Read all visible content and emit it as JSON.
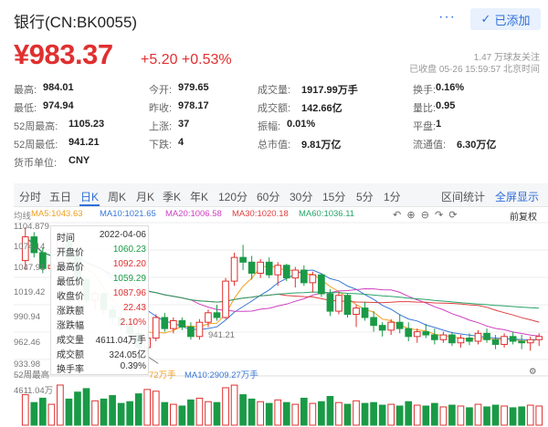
{
  "header": {
    "title": "银行(CN:BK0055)",
    "more": "···",
    "add_label": "已添加",
    "price": "¥983.37",
    "change": "+5.20 +0.53%",
    "followers": "1.47 万球友关注",
    "status": "已收盘 05-26 15:59:57 北京时间"
  },
  "stats": [
    [
      {
        "label": "最高:",
        "value": "984.01",
        "color": "red"
      },
      {
        "label": "今开:",
        "value": "979.65",
        "color": "red"
      },
      {
        "label": "成交量:",
        "value": "1917.99万手",
        "color": ""
      },
      {
        "label": "换手:",
        "value": "0.16%",
        "color": ""
      }
    ],
    [
      {
        "label": "最低:",
        "value": "974.94",
        "color": "green"
      },
      {
        "label": "昨收:",
        "value": "978.17",
        "color": ""
      },
      {
        "label": "成交额:",
        "value": "142.66亿",
        "color": ""
      },
      {
        "label": "量比:",
        "value": "0.95",
        "color": "green"
      }
    ],
    [
      {
        "label": "52周最高:",
        "value": "1105.23",
        "color": ""
      },
      {
        "label": "上涨:",
        "value": "37",
        "color": ""
      },
      {
        "label": "振幅:",
        "value": "0.01%",
        "color": ""
      },
      {
        "label": "平盘:",
        "value": "1",
        "color": ""
      }
    ],
    [
      {
        "label": "52周最低:",
        "value": "941.21",
        "color": ""
      },
      {
        "label": "下跌:",
        "value": "4",
        "color": ""
      },
      {
        "label": "总市值:",
        "value": "9.81万亿",
        "color": ""
      },
      {
        "label": "流通值:",
        "value": "6.30万亿",
        "color": ""
      }
    ],
    [
      {
        "label": "货币单位:",
        "value": "CNY",
        "color": ""
      }
    ]
  ],
  "tabs": [
    "分时",
    "五日",
    "日K",
    "周K",
    "月K",
    "季K",
    "年K",
    "120分",
    "60分",
    "30分",
    "15分",
    "5分",
    "1分"
  ],
  "active_tab": "日K",
  "right_links": {
    "stats": "区间统计",
    "fullscreen": "全屏显示"
  },
  "ma_bar": {
    "label": "均线",
    "items": [
      {
        "text": "MA5:1043.63",
        "color": "#f0a020"
      },
      {
        "text": "MA10:1021.65",
        "color": "#3a78d6"
      },
      {
        "text": "MA20:1006.58",
        "color": "#d040c0"
      },
      {
        "text": "MA30:1020.18",
        "color": "#e04040"
      },
      {
        "text": "MA60:1036.11",
        "color": "#2aa36a"
      }
    ],
    "adjust_label": "前复权"
  },
  "y_axis": [
    "1104.879",
    "1074.14",
    "1047.91",
    "1019.42",
    "990.94",
    "962.46",
    "933.98"
  ],
  "vol_labels": {
    "header": "52周最高",
    "ma_text": "72万手",
    "ma10_text": "MA10:2909.27万手",
    "top": "4611.04万"
  },
  "low_marker": "941.21",
  "tooltip": [
    {
      "label": "时间",
      "value": "2022-04-06",
      "color": ""
    },
    {
      "label": "开盘价",
      "value": "1060.23",
      "color": "green"
    },
    {
      "label": "最高价",
      "value": "1092.20",
      "color": "red"
    },
    {
      "label": "最低价",
      "value": "1059.29",
      "color": "green"
    },
    {
      "label": "收盘价",
      "value": "1087.96",
      "color": "red"
    },
    {
      "label": "涨跌额",
      "value": "22.43",
      "color": "red"
    },
    {
      "label": "涨跌幅",
      "value": "2.10%",
      "color": "red"
    },
    {
      "label": "成交量",
      "value": "4611.04万手",
      "color": ""
    },
    {
      "label": "成交额",
      "value": "324.05亿",
      "color": ""
    },
    {
      "label": "换手率",
      "value": "0.39%",
      "color": ""
    }
  ],
  "chart_data": {
    "type": "candlestick",
    "ohlc": [
      [
        1062,
        1104,
        1050,
        1092
      ],
      [
        1092,
        1098,
        1066,
        1072
      ],
      [
        1072,
        1078,
        1046,
        1052
      ],
      [
        1052,
        1060,
        1040,
        1056
      ],
      [
        1060,
        1092,
        1059,
        1088
      ],
      [
        1088,
        1090,
        1060,
        1066
      ],
      [
        1066,
        1068,
        1032,
        1038
      ],
      [
        1038,
        1040,
        1008,
        1012
      ],
      [
        1012,
        1024,
        1000,
        1020
      ],
      [
        1020,
        1022,
        995,
        1000
      ],
      [
        1000,
        1006,
        982,
        990
      ],
      [
        990,
        998,
        975,
        980
      ],
      [
        980,
        992,
        966,
        970
      ],
      [
        970,
        976,
        950,
        952
      ],
      [
        952,
        968,
        941,
        964
      ],
      [
        964,
        994,
        960,
        990
      ],
      [
        990,
        996,
        972,
        976
      ],
      [
        976,
        990,
        970,
        986
      ],
      [
        986,
        990,
        974,
        978
      ],
      [
        978,
        984,
        962,
        966
      ],
      [
        966,
        988,
        962,
        984
      ],
      [
        984,
        1000,
        978,
        996
      ],
      [
        996,
        1006,
        986,
        990
      ],
      [
        990,
        1040,
        988,
        1036
      ],
      [
        1036,
        1072,
        1030,
        1066
      ],
      [
        1066,
        1082,
        1050,
        1060
      ],
      [
        1060,
        1068,
        1038,
        1046
      ],
      [
        1046,
        1064,
        1040,
        1060
      ],
      [
        1060,
        1066,
        1040,
        1044
      ],
      [
        1044,
        1060,
        1030,
        1056
      ],
      [
        1056,
        1058,
        1036,
        1040
      ],
      [
        1040,
        1054,
        1028,
        1050
      ],
      [
        1050,
        1056,
        1030,
        1034
      ],
      [
        1034,
        1048,
        1022,
        1044
      ],
      [
        1044,
        1046,
        1016,
        1020
      ],
      [
        1020,
        1026,
        992,
        998
      ],
      [
        998,
        1022,
        994,
        1018
      ],
      [
        1018,
        1020,
        990,
        994
      ],
      [
        994,
        1006,
        978,
        1002
      ],
      [
        1002,
        1010,
        986,
        990
      ],
      [
        990,
        998,
        972,
        980
      ],
      [
        980,
        984,
        966,
        974
      ],
      [
        974,
        988,
        968,
        984
      ],
      [
        984,
        994,
        970,
        976
      ],
      [
        976,
        984,
        960,
        966
      ],
      [
        966,
        976,
        958,
        972
      ],
      [
        972,
        982,
        964,
        968
      ],
      [
        968,
        976,
        956,
        962
      ],
      [
        962,
        972,
        958,
        968
      ],
      [
        968,
        972,
        954,
        958
      ],
      [
        958,
        968,
        952,
        964
      ],
      [
        964,
        970,
        955,
        960
      ],
      [
        960,
        974,
        956,
        970
      ],
      [
        970,
        976,
        958,
        962
      ],
      [
        962,
        968,
        950,
        956
      ],
      [
        956,
        970,
        952,
        966
      ],
      [
        966,
        972,
        956,
        960
      ],
      [
        960,
        968,
        950,
        958
      ],
      [
        958,
        966,
        948,
        962
      ],
      [
        962,
        970,
        954,
        966
      ]
    ],
    "volume": [
      3500,
      2600,
      3100,
      2400,
      4611,
      3000,
      3800,
      4200,
      2800,
      3000,
      3400,
      2500,
      2700,
      3600,
      4100,
      3900,
      2600,
      2400,
      2200,
      2900,
      3100,
      2700,
      2600,
      4300,
      4600,
      3500,
      3000,
      2700,
      2500,
      2900,
      2600,
      2400,
      3100,
      2500,
      2700,
      3300,
      2600,
      2400,
      2800,
      2500,
      2600,
      2300,
      2400,
      2200,
      2700,
      2300,
      2200,
      2500,
      2100,
      2300,
      2200,
      2000,
      2400,
      2100,
      2300,
      2200,
      2000,
      2100,
      2300,
      2200
    ],
    "ylim": [
      930,
      1110
    ],
    "low_label": "941.21"
  }
}
